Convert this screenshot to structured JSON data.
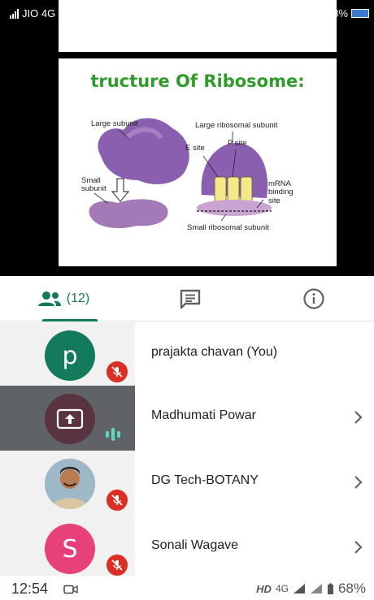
{
  "status_bar": {
    "carrier": "JIO 4G",
    "battery_text": "8%",
    "signal_badge": "4G"
  },
  "slide": {
    "title": "tructure Of Ribosome:",
    "labels": {
      "large_subunit": "Large subunit",
      "small_subunit": "Small\nsubunit",
      "large_ribosomal_subunit": "Large ribosomal subunit",
      "e_site": "E site",
      "p_site": "P site",
      "mrna_binding_site": "mRNA\nbinding\nsite",
      "small_ribosomal_subunit": "Small ribosomal subunit"
    },
    "colors": {
      "title": "#2f9c2a",
      "subunit": "#8a5fb0",
      "small_subunit": "#a479b8",
      "site_fill": "#f3e98a"
    }
  },
  "tabs": {
    "people_count": "(12)",
    "active": "people",
    "accent_color": "#137a5c",
    "icons": [
      "people-icon",
      "chat-icon",
      "info-icon"
    ]
  },
  "participants": [
    {
      "initial": "p",
      "name": "prajakta chavan (You)",
      "avatar_color": "#137a5c",
      "status": "muted",
      "chevron": false
    },
    {
      "initial": "",
      "name": "Madhumati Powar",
      "avatar_color": "#5a3340",
      "status": "speaking",
      "presenting": true,
      "chevron": true
    },
    {
      "initial": "",
      "name": "DG Tech-BOTANY",
      "avatar_color": "#c49a6c",
      "status": "muted",
      "chevron": true
    },
    {
      "initial": "S",
      "name": "Sonali Wagave",
      "avatar_color": "#e8407a",
      "status": "muted",
      "chevron": true
    }
  ],
  "system_bar": {
    "time": "12:54",
    "hd": "HD",
    "network": "4G",
    "battery": "68%"
  }
}
